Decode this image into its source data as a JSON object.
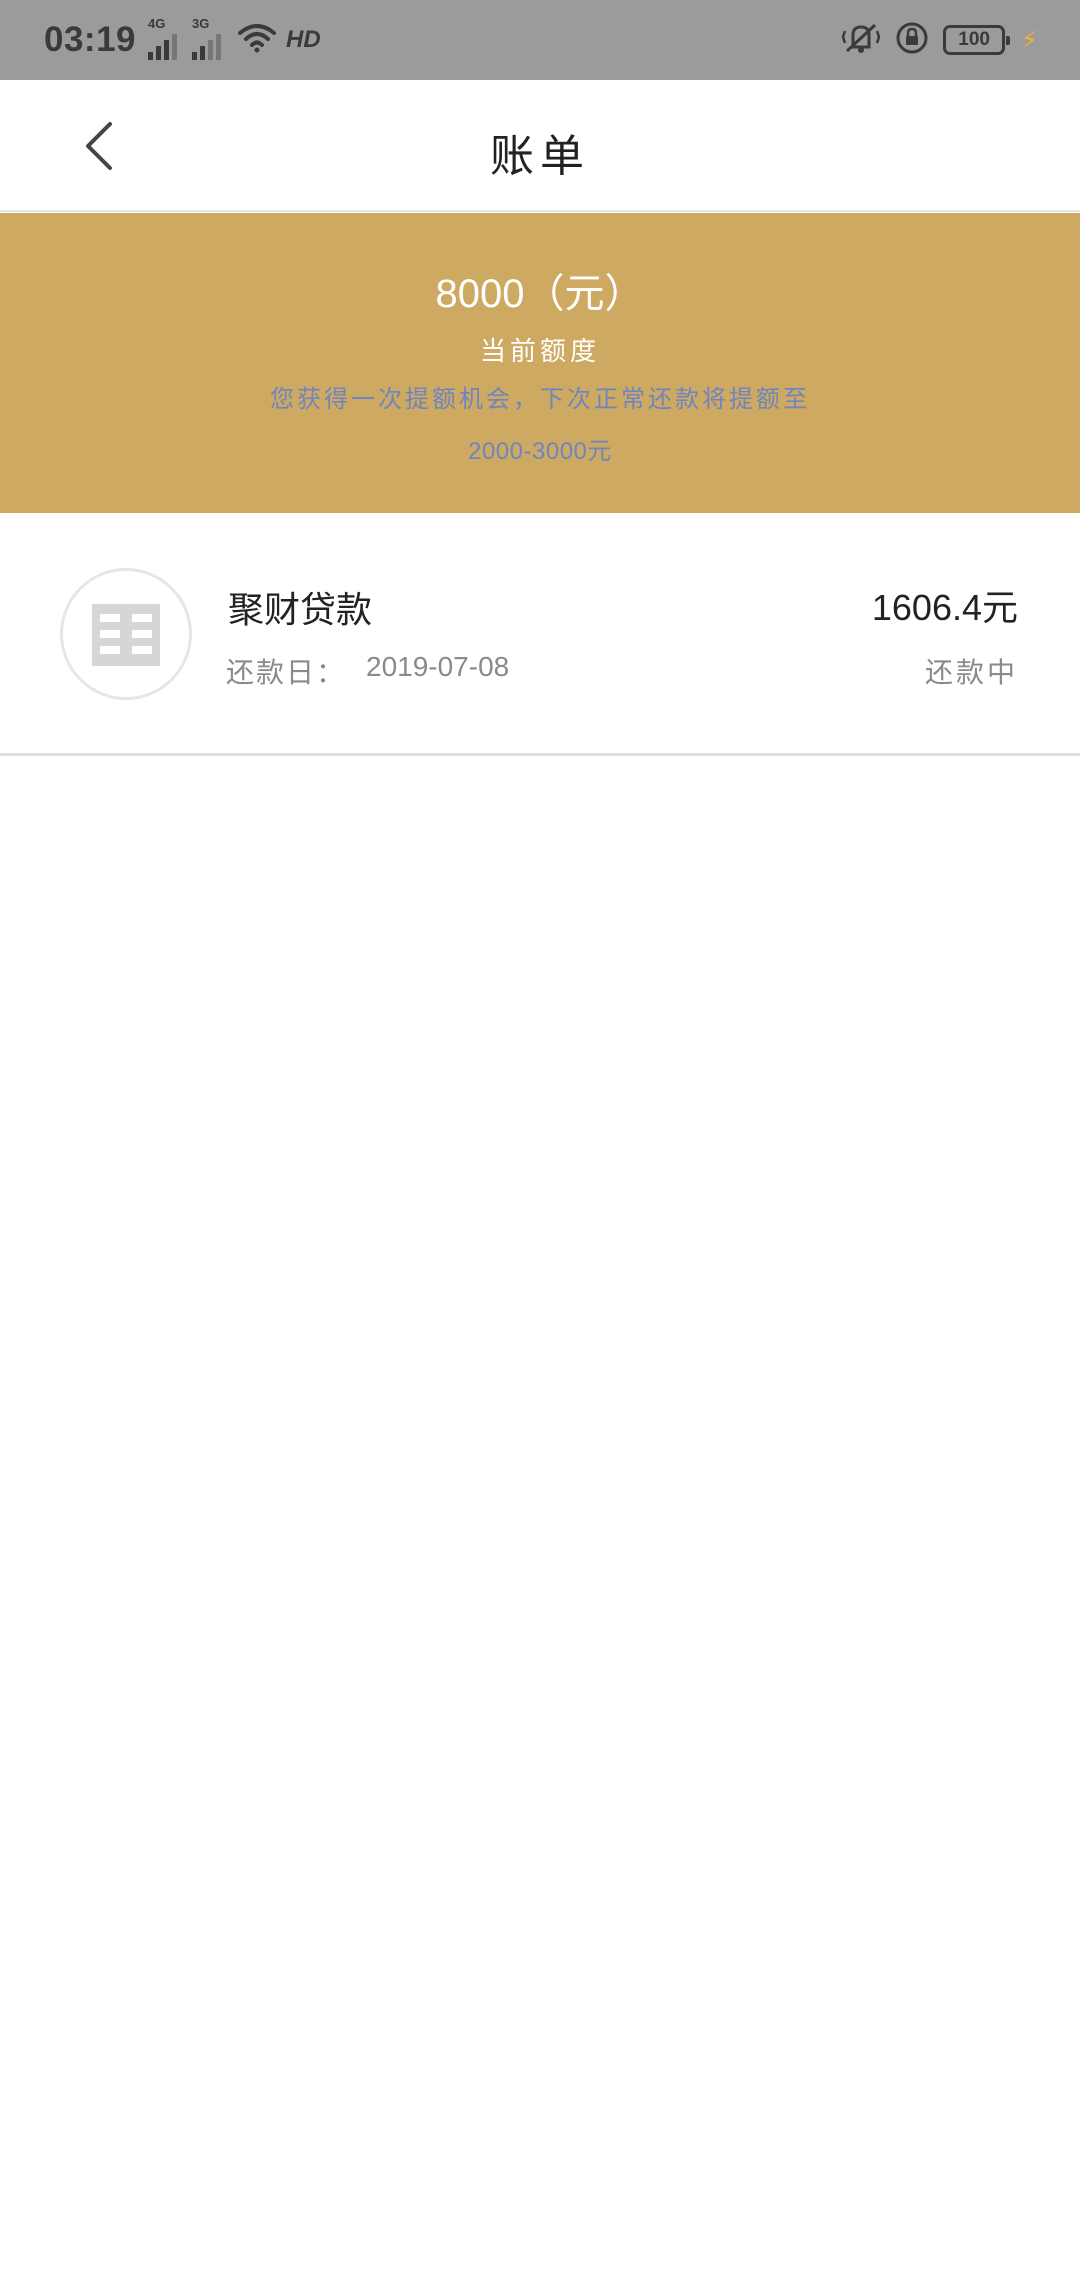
{
  "status_bar": {
    "time": "03:19",
    "signal_1_tag": "4G",
    "signal_2_tag": "3G",
    "hd_label": "HD",
    "battery_level": "100",
    "bolt_glyph": "⚡"
  },
  "header": {
    "title": "账单",
    "back_icon": "chevron-left-icon"
  },
  "banner": {
    "limit_value": "8000（元）",
    "limit_label": "当前额度",
    "promo_line_1": "您获得一次提额机会，下次正常还款将提额至",
    "promo_line_2": "2000-3000元",
    "background_color": "#cda961",
    "promo_color": "#6f85c1"
  },
  "bills": [
    {
      "logo_icon": "building-icon",
      "name": "聚财贷款",
      "date_label": "还款日：",
      "date": "2019-07-08",
      "amount": "1606.4元",
      "status": "还款中"
    }
  ]
}
